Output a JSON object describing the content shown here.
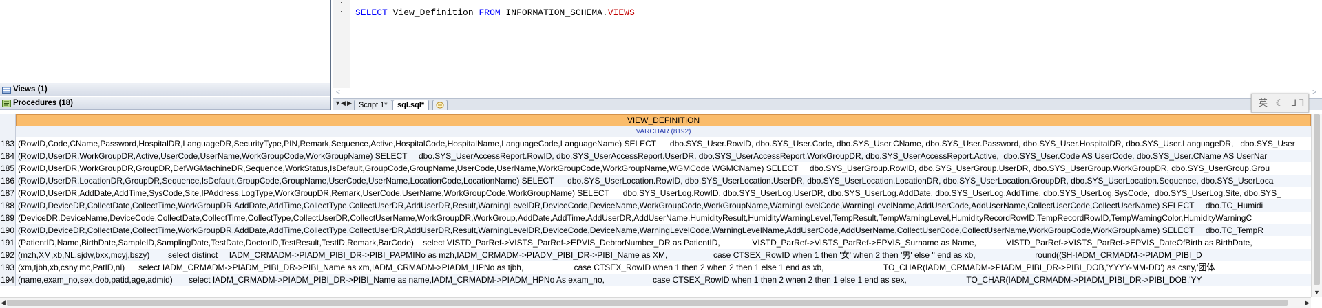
{
  "tree": {
    "views_label": "Views (1)",
    "procedures_label": "Procedures (18)"
  },
  "editor": {
    "kw_select": "SELECT",
    "col": "View_Definition",
    "kw_from": "FROM",
    "schema": "INFORMATION_SCHEMA.",
    "table": "VIEWS"
  },
  "tabs": [
    {
      "label": "Script 1*"
    },
    {
      "label": "sql.sql*"
    }
  ],
  "ime": {
    "text": "英 ☾ ⅃⅂"
  },
  "grid": {
    "column_name": "VIEW_DEFINITION",
    "column_type": "VARCHAR (8192)",
    "rows": [
      {
        "n": "183",
        "v": "(RowID,Code,CName,Password,HospitalDR,LanguageDR,SecurityType,PIN,Remark,Sequence,Active,HospitalCode,HospitalName,LanguageCode,LanguageName) SELECT      dbo.SYS_User.RowID, dbo.SYS_User.Code, dbo.SYS_User.CName, dbo.SYS_User.Password, dbo.SYS_User.HospitalDR, dbo.SYS_User.LanguageDR,   dbo.SYS_User"
      },
      {
        "n": "184",
        "v": "(RowID,UserDR,WorkGroupDR,Active,UserCode,UserName,WorkGroupCode,WorkGroupName) SELECT     dbo.SYS_UserAccessReport.RowID, dbo.SYS_UserAccessReport.UserDR, dbo.SYS_UserAccessReport.WorkGroupDR, dbo.SYS_UserAccessReport.Active,  dbo.SYS_User.Code AS UserCode, dbo.SYS_User.CName AS UserNar"
      },
      {
        "n": "185",
        "v": "(RowID,UserDR,WorkGroupDR,GroupDR,DefWGMachineDR,Sequence,WorkStatus,IsDefault,GroupCode,GroupName,UserCode,UserName,WorkGroupCode,WorkGroupName,WGMCode,WGMCName) SELECT     dbo.SYS_UserGroup.RowID, dbo.SYS_UserGroup.UserDR, dbo.SYS_UserGroup.WorkGroupDR, dbo.SYS_UserGroup.Grou"
      },
      {
        "n": "186",
        "v": "(RowID,UserDR,LocationDR,GroupDR,Sequence,IsDefault,GroupCode,GroupName,UserCode,UserName,LocationCode,LocationName) SELECT      dbo.SYS_UserLocation.RowID, dbo.SYS_UserLocation.UserDR, dbo.SYS_UserLocation.LocationDR, dbo.SYS_UserLocation.GroupDR, dbo.SYS_UserLocation.Sequence, dbo.SYS_UserLoca"
      },
      {
        "n": "187",
        "v": "(RowID,UserDR,AddDate,AddTime,SysCode,Site,IPAddress,LogType,WorkGroupDR,Remark,UserCode,UserName,WorkGroupCode,WorkGroupName) SELECT      dbo.SYS_UserLog.RowID, dbo.SYS_UserLog.UserDR, dbo.SYS_UserLog.AddDate, dbo.SYS_UserLog.AddTime, dbo.SYS_UserLog.SysCode,  dbo.SYS_UserLog.Site, dbo.SYS_"
      },
      {
        "n": "188",
        "v": "(RowID,DeviceDR,CollectDate,CollectTime,WorkGroupDR,AddDate,AddTime,CollectType,CollectUserDR,AddUserDR,Result,WarningLevelDR,DeviceCode,DeviceName,WorkGroupCode,WorkGroupName,WarningLevelCode,WarningLevelName,AddUserCode,AddUserName,CollectUserCode,CollectUserName) SELECT     dbo.TC_Humidi"
      },
      {
        "n": "189",
        "v": "(DeviceDR,DeviceName,DeviceCode,CollectDate,CollectTime,CollectType,CollectUserDR,CollectUserName,WorkGroupDR,WorkGroup,AddDate,AddTime,AddUserDR,AddUserName,HumidityResult,HumidityWarningLevel,TempResult,TempWarningLevel,HumidityRecordRowID,TempRecordRowID,TempWarningColor,HumidityWarningC"
      },
      {
        "n": "190",
        "v": "(RowID,DeviceDR,CollectDate,CollectTime,WorkGroupDR,AddDate,AddTime,CollectType,CollectUserDR,AddUserDR,Result,WarningLevelDR,DeviceCode,DeviceName,WarningLevelCode,WarningLevelName,AddUserCode,AddUserName,CollectUserCode,CollectUserName,WorkGroupCode,WorkGroupName) SELECT     dbo.TC_TempR"
      },
      {
        "n": "191",
        "v": "(PatientID,Name,BirthDate,SampleID,SamplingDate,TestDate,DoctorID,TestResult,TestID,Remark,BarCode)    select VISTD_ParRef->VISTS_ParRef->EPVIS_DebtorNumber_DR as PatientID,              VISTD_ParRef->VISTS_ParRef->EPVIS_Surname as Name,             VISTD_ParRef->VISTS_ParRef->EPVIS_DateOfBirth as BirthDate,"
      },
      {
        "n": "192",
        "v": "(mzh,XM,xb,NL,sjdw,bxx,mcyj,bszy)        select distinct     IADM_CRMADM->PIADM_PIBI_DR->PIBI_PAPMINo as mzh,IADM_CRMADM->PIADM_PIBI_DR->PIBI_Name as XM,                    case CTSEX_RowID when 1 then '女' when 2 then '男' else '' end as xb,                          round(($H-IADM_CRMADM->PIADM_PIBI_D"
      },
      {
        "n": "193",
        "v": "(xm,tjbh,xb,csny,mc,PatID,nl)      select IADM_CRMADM->PIADM_PIBI_DR->PIBI_Name as xm,IADM_CRMADM->PIADM_HPNo as tjbh,                      case CTSEX_RowID when 1 then 2 when 2 then 1 else 1 end as xb,                          TO_CHAR(IADM_CRMADM->PIADM_PIBI_DR->PIBI_DOB,'YYYY-MM-DD') as csny,'团体"
      },
      {
        "n": "194",
        "v": "(name,exam_no,sex,dob,patid,age,admid)       select IADM_CRMADM->PIADM_PIBI_DR->PIBI_Name as name,IADM_CRMADM->PIADM_HPNo As exam_no,                     case CTSEX_RowID when 1 then 2 when 2 then 1 else 1 end as sex,                          TO_CHAR(IADM_CRMADM->PIADM_PIBI_DR->PIBI_DOB,'YY"
      }
    ]
  }
}
